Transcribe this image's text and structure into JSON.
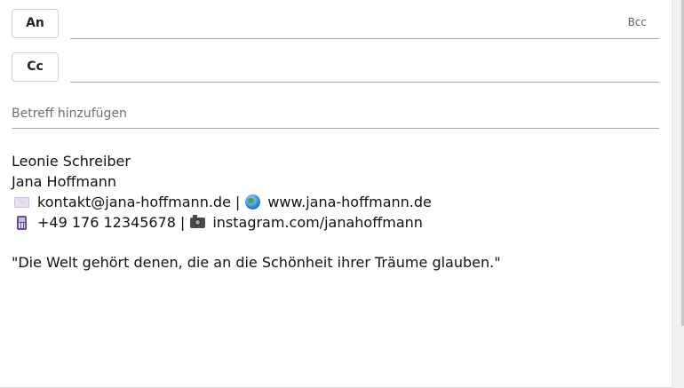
{
  "recipients": {
    "to_label": "An",
    "to_value": "",
    "cc_label": "Cc",
    "cc_value": "",
    "bcc_label": "Bcc"
  },
  "subject": {
    "placeholder": "Betreff hinzufügen",
    "value": ""
  },
  "body": {
    "name_line_1": "Leonie Schreiber",
    "name_line_2": "Jana Hoffmann",
    "email": "kontakt@jana-hoffmann.de",
    "separator_1": "|",
    "website": "www.jana-hoffmann.de",
    "phone": "+49 176 12345678",
    "separator_2": "|",
    "instagram": "instagram.com/janahoffmann",
    "quote": "\"Die Welt gehört denen, die an die Schönheit ihrer Träume glauben.\""
  },
  "icons": {
    "email": "envelope-icon",
    "website": "globe-icon",
    "phone": "mobile-phone-icon",
    "instagram": "camera-icon"
  }
}
